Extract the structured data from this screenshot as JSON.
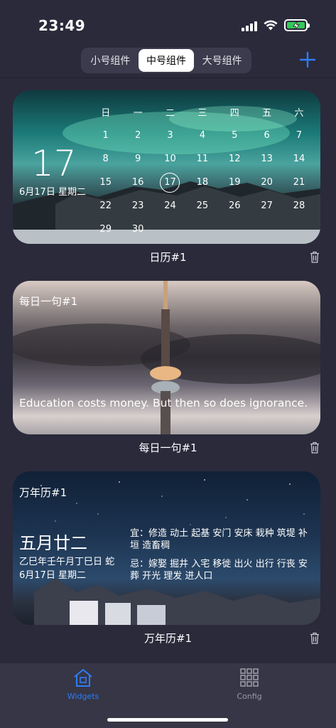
{
  "status_bar": {
    "time": "23:49"
  },
  "segments": {
    "items": [
      {
        "label": "小号组件"
      },
      {
        "label": "中号组件"
      },
      {
        "label": "大号组件"
      }
    ]
  },
  "calendar": {
    "big_day": "17",
    "date_text": "6月17日 星期二",
    "weekdays": [
      "日",
      "一",
      "二",
      "三",
      "四",
      "五",
      "六"
    ],
    "weeks": [
      [
        "1",
        "2",
        "3",
        "4",
        "5",
        "6",
        "7"
      ],
      [
        "8",
        "9",
        "10",
        "11",
        "12",
        "13",
        "14"
      ],
      [
        "15",
        "16",
        "17",
        "18",
        "19",
        "20",
        "21"
      ],
      [
        "22",
        "23",
        "24",
        "25",
        "26",
        "27",
        "28"
      ],
      [
        "29",
        "30",
        "",
        "",
        "",
        "",
        ""
      ]
    ],
    "today": "17",
    "caption": "日历#1"
  },
  "quote": {
    "title": "每日一句#1",
    "text": "Education costs money. But then so does ignorance.",
    "caption": "每日一句#1"
  },
  "almanac": {
    "title": "万年历#1",
    "lunar_date": "五月廿二",
    "ganzhi": "乙巳年壬午月丁巳日 蛇",
    "date_text": "6月17日 星期二",
    "yi": "宜：修造 动土 起基 安门 安床 栽种 筑堤 补垣 造畜稠",
    "ji": "忌：嫁娶 掘井 入宅 移徙 出火 出行 行丧 安葬 开光 理发 进人口",
    "caption": "万年历#1"
  },
  "tab_bar": {
    "widgets_label": "Widgets",
    "config_label": "Config",
    "active_color": "#2f7cf6",
    "inactive_color": "#9a9aa6"
  },
  "colors": {
    "accent": "#2f7cf6",
    "battery": "#34c759"
  },
  "icons": [
    "signal-icon",
    "wifi-icon",
    "battery-icon",
    "plus-icon",
    "trash-icon",
    "home-icon",
    "grid-icon"
  ]
}
